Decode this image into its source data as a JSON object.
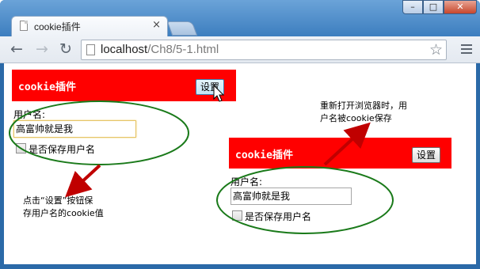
{
  "browser": {
    "tab_title": "cookie插件",
    "tab_close_glyph": "×",
    "url_host": "localhost",
    "url_path": "/Ch8/5-1.html",
    "back_glyph": "←",
    "forward_glyph": "→",
    "reload_glyph": "↻",
    "star_glyph": "☆",
    "win_min": "–",
    "win_max": "□",
    "win_close": "✕"
  },
  "left_demo": {
    "panel_title": "cookie插件",
    "settings_button": "设置",
    "username_label": "用户名:",
    "username_value": "高富帅就是我",
    "remember_label": "是否保存用户名"
  },
  "right_demo": {
    "panel_title": "cookie插件",
    "settings_button": "设置",
    "username_label": "用户名:",
    "username_value": "高富帅就是我",
    "remember_label": "是否保存用户名"
  },
  "annotations": {
    "left_note_line1": "点击“设置”按钮保",
    "left_note_line2": "存用户名的cookie值",
    "right_note_line1": "重新打开浏览器时，用",
    "right_note_line2": "户名被cookie保存"
  },
  "colors": {
    "panel_red": "#ff0000",
    "ellipse_green": "#1a7a1a",
    "arrow_red": "#c00000"
  }
}
